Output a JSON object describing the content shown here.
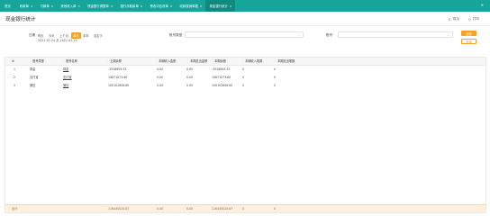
{
  "tabs": [
    {
      "label": "首页",
      "active": false,
      "closable": false
    },
    {
      "label": "收款单",
      "active": false,
      "closable": true
    },
    {
      "label": "付款单",
      "active": false,
      "closable": true
    },
    {
      "label": "其他收入单",
      "active": false,
      "closable": true
    },
    {
      "label": "现金银行调整单",
      "active": false,
      "closable": true
    },
    {
      "label": "银行存取款单",
      "active": false,
      "closable": true
    },
    {
      "label": "预收冲应收单",
      "active": false,
      "closable": true
    },
    {
      "label": "收款核销单据",
      "active": false,
      "closable": true
    },
    {
      "label": "现金银行统计",
      "active": true,
      "closable": true
    }
  ],
  "tab_more_icon": "close-icon",
  "page_title": "现金银行统计",
  "actions": {
    "export_label": "导出",
    "print_label": "打印"
  },
  "filters": {
    "date_label": "日期",
    "quick_ranges": [
      "昨天",
      "今天",
      "上个月",
      "本月",
      "本年",
      "自定义"
    ],
    "selected_range": "本月",
    "date_from": "2021-02-24",
    "date_to_sep": "至",
    "date_to": "2021-03-24",
    "account_type_label": "账号类型",
    "account_label": "账号",
    "search_label": "搜索",
    "reset_label": "重置"
  },
  "table": {
    "columns": [
      "账号类型",
      "账号名称",
      "上期余额",
      "本期收入金额",
      "本期支出金额",
      "本期余额",
      "本期收入笔数",
      "本期支出笔数"
    ],
    "rows": [
      {
        "no": "1",
        "type": "现金",
        "name": "现金",
        "prev": "-3528659.33",
        "income": "0.00",
        "expense": "0.00",
        "balance": "-3528659.33",
        "in_count": "0",
        "out_count": "0"
      },
      {
        "no": "2",
        "type": "支付宝",
        "name": "支付宝",
        "prev": "19871073.60",
        "income": "0.00",
        "expense": "0.00",
        "balance": "19871073.60",
        "in_count": "0",
        "out_count": "0"
      },
      {
        "no": "3",
        "type": "微信",
        "name": "微信",
        "prev": "100102606.60",
        "income": "0.00",
        "expense": "0.00",
        "balance": "100102606.60",
        "in_count": "0",
        "out_count": "0"
      }
    ],
    "footer": {
      "label": "合计",
      "prev": "116445020.87",
      "income": "0.00",
      "expense": "0.00",
      "balance": "116445020.87",
      "in_count": "0",
      "out_count": "0"
    }
  },
  "colors": {
    "tabbar": "#15a59b",
    "accent": "#f3a127",
    "footer_bg": "#fdf1dc"
  }
}
